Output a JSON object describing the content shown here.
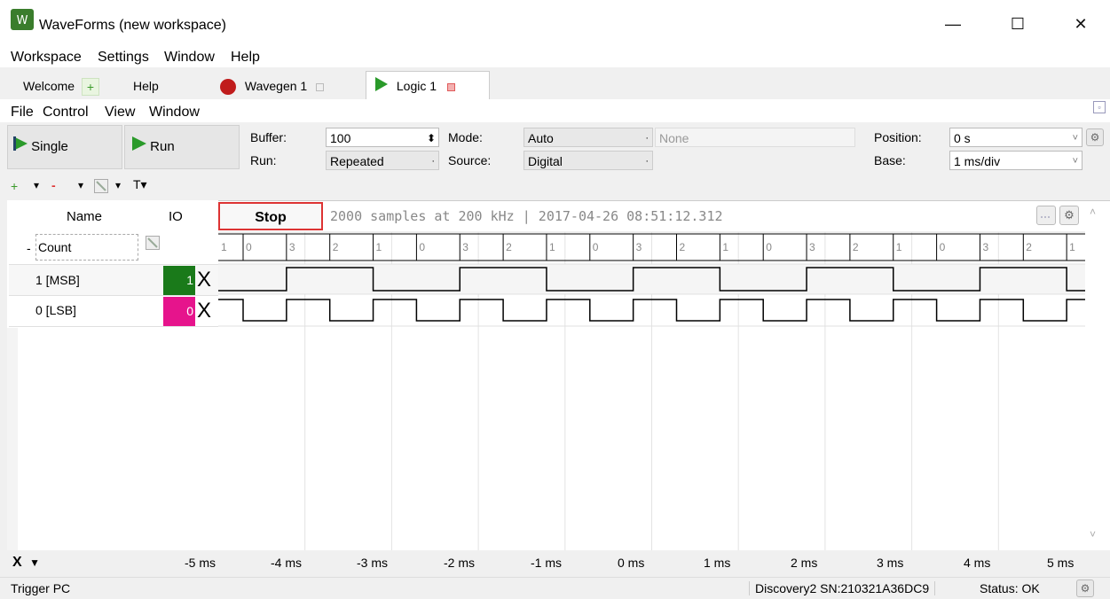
{
  "window": {
    "title": "WaveForms  (new workspace)",
    "controls": [
      "—",
      "☐",
      "✕"
    ]
  },
  "menubar": {
    "items": [
      "Workspace",
      "Settings",
      "Window",
      "Help"
    ]
  },
  "tabs": [
    {
      "label": "Welcome",
      "icon": "plus-icon"
    },
    {
      "label": "Help"
    },
    {
      "label": "Wavegen 1",
      "icon": "record-icon"
    },
    {
      "label": "Logic 1",
      "icon": "play-icon",
      "active": true
    }
  ],
  "submenu": {
    "items": [
      "File",
      "Control",
      "View",
      "Window"
    ]
  },
  "toolbar": {
    "single_label": "Single",
    "run_label": "Run",
    "buffer_label": "Buffer:",
    "buffer_value": "100",
    "run_mode_label": "Run:",
    "run_mode_value": "Repeated",
    "mode_label": "Mode:",
    "mode_value": "Auto",
    "source_label": "Source:",
    "source_value": "Digital",
    "trigger_value": "None",
    "position_label": "Position:",
    "position_value": "0 s",
    "base_label": "Base:",
    "base_value": "1 ms/div"
  },
  "channels": {
    "header_name": "Name",
    "header_io": "IO",
    "rows": [
      {
        "name": "Count",
        "prefix": "-",
        "type": "bus"
      },
      {
        "name": "1 [MSB]",
        "io": "1",
        "io_color": "#1a7a1a",
        "trigger": "X"
      },
      {
        "name": "0 [LSB]",
        "io": "0",
        "io_color": "#e6148c",
        "trigger": "X"
      }
    ]
  },
  "acquisition": {
    "stop_label": "Stop",
    "info": "2000 samples at 200 kHz | 2017-04-26 08:51:12.312"
  },
  "bus_values": [
    "1",
    "0",
    "3",
    "2",
    "1",
    "0",
    "3",
    "2",
    "1",
    "0",
    "3",
    "2",
    "1",
    "0",
    "3",
    "2",
    "1",
    "0",
    "3",
    "2",
    "1"
  ],
  "axis": {
    "label": "X",
    "ticks": [
      "-5 ms",
      "-4 ms",
      "-3 ms",
      "-2 ms",
      "-1 ms",
      "0 ms",
      "1 ms",
      "2 ms",
      "3 ms",
      "4 ms",
      "5 ms"
    ]
  },
  "statusbar": {
    "left": "Trigger PC",
    "device": "Discovery2 SN:210321A36DC9",
    "status": "Status: OK"
  }
}
